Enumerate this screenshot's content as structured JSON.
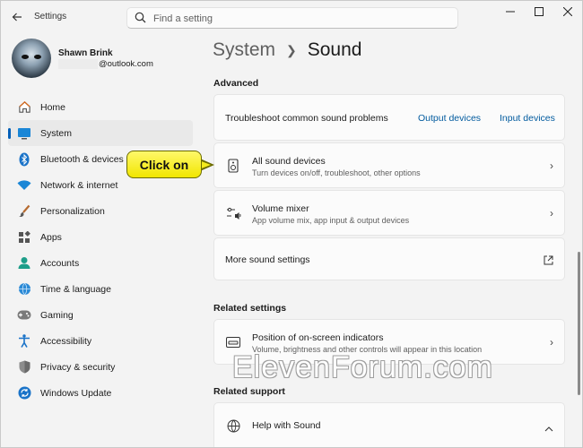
{
  "window": {
    "app_title": "Settings"
  },
  "search": {
    "placeholder": "Find a setting"
  },
  "profile": {
    "name": "Shawn Brink",
    "email_suffix": "@outlook.com"
  },
  "sidebar": {
    "items": [
      {
        "label": "Home",
        "icon": "home-icon"
      },
      {
        "label": "System",
        "icon": "system-icon",
        "active": true
      },
      {
        "label": "Bluetooth & devices",
        "icon": "bluetooth-icon"
      },
      {
        "label": "Network & internet",
        "icon": "wifi-icon"
      },
      {
        "label": "Personalization",
        "icon": "brush-icon"
      },
      {
        "label": "Apps",
        "icon": "apps-icon"
      },
      {
        "label": "Accounts",
        "icon": "accounts-icon"
      },
      {
        "label": "Time & language",
        "icon": "globe-icon"
      },
      {
        "label": "Gaming",
        "icon": "gamepad-icon"
      },
      {
        "label": "Accessibility",
        "icon": "accessibility-icon"
      },
      {
        "label": "Privacy & security",
        "icon": "shield-icon"
      },
      {
        "label": "Windows Update",
        "icon": "update-icon"
      }
    ]
  },
  "header": {
    "parent": "System",
    "current": "Sound"
  },
  "advanced": {
    "title": "Advanced",
    "troubleshoot": {
      "label": "Troubleshoot common sound problems",
      "link_output": "Output devices",
      "link_input": "Input devices"
    },
    "all_devices": {
      "title": "All sound devices",
      "desc": "Turn devices on/off, troubleshoot, other options"
    },
    "mixer": {
      "title": "Volume mixer",
      "desc": "App volume mix, app input & output devices"
    },
    "more": {
      "title": "More sound settings"
    }
  },
  "related_settings": {
    "title": "Related settings",
    "indicators": {
      "title": "Position of on-screen indicators",
      "desc": "Volume, brightness and other controls will appear in this location"
    }
  },
  "related_support": {
    "title": "Related support",
    "help": {
      "title": "Help with Sound"
    }
  },
  "callout": {
    "text": "Click on"
  },
  "watermark": {
    "text": "ElevenForum.com"
  },
  "colors": {
    "accent": "#005fb8",
    "link": "#005a9e",
    "callout": "#f4ea1c"
  }
}
